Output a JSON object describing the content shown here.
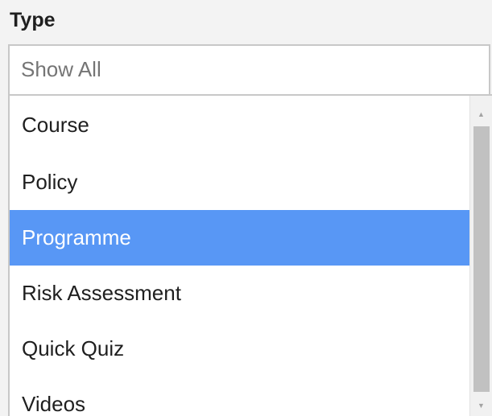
{
  "field": {
    "label": "Type",
    "value": "Show All"
  },
  "dropdown": {
    "options": [
      "Course",
      "Policy",
      "Programme",
      "Risk Assessment",
      "Quick Quiz",
      "Videos"
    ],
    "highlighted": "Programme"
  },
  "scrollbar": {
    "up_icon": "scroll-up-arrow",
    "down_icon": "scroll-down-arrow"
  },
  "colors": {
    "highlight": "#5897f5",
    "highlight_text": "#ffffff",
    "border": "#c8c8c8",
    "placeholder_text": "#757575"
  }
}
